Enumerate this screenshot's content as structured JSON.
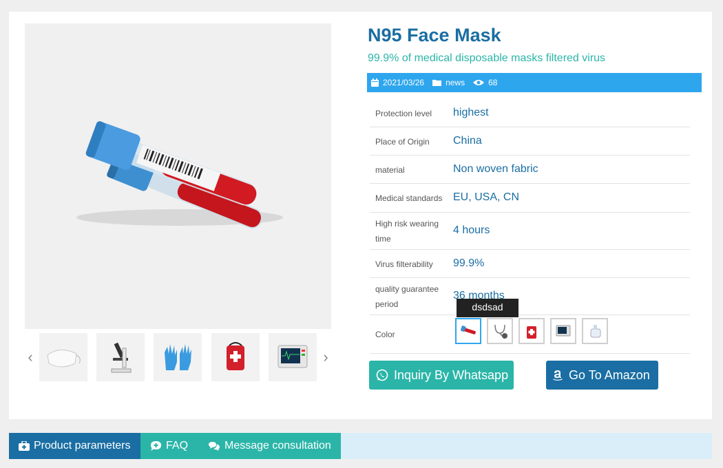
{
  "product": {
    "title": "N95 Face Mask",
    "subtitle": "99.9% of medical disposable masks filtered virus"
  },
  "meta": {
    "date": "2021/03/26",
    "category": "news",
    "views": "68",
    "icons": [
      "calendar-icon",
      "folder-icon",
      "eye-icon"
    ]
  },
  "params": [
    {
      "name": "Protection level",
      "value": "highest"
    },
    {
      "name": "Place of Origin",
      "value": "China"
    },
    {
      "name": "material",
      "value": "Non woven fabric"
    },
    {
      "name": "Medical standards",
      "value": "EU, USA, CN"
    },
    {
      "name": "High risk wearing time",
      "value": "4 hours"
    },
    {
      "name": "Virus filterability",
      "value": "99.9%"
    },
    {
      "name": "quality guarantee period",
      "value": "36 months"
    }
  ],
  "color": {
    "label": "Color",
    "tooltip": "dsdsad",
    "selected_index": 0,
    "options": [
      "blood-tube",
      "stethoscope",
      "first-aid-bag",
      "patient-monitor",
      "spray-bottle"
    ]
  },
  "gallery": {
    "main": "blood-collection-tubes",
    "thumbnails": [
      "mask",
      "microscope",
      "gloves",
      "first-aid-bag",
      "patient-monitor"
    ]
  },
  "buttons": {
    "whatsapp": "Inquiry By Whatsapp",
    "amazon": "Go To Amazon"
  },
  "tabs": [
    {
      "label": "Product parameters",
      "active": true
    },
    {
      "label": "FAQ",
      "active": false
    },
    {
      "label": "Message consultation",
      "active": false
    }
  ],
  "colors": {
    "primary": "#1a6ea3",
    "teal": "#2bb5a8",
    "meta_bar": "#2ea6ee",
    "tab_bar_bg": "#daeef9"
  }
}
